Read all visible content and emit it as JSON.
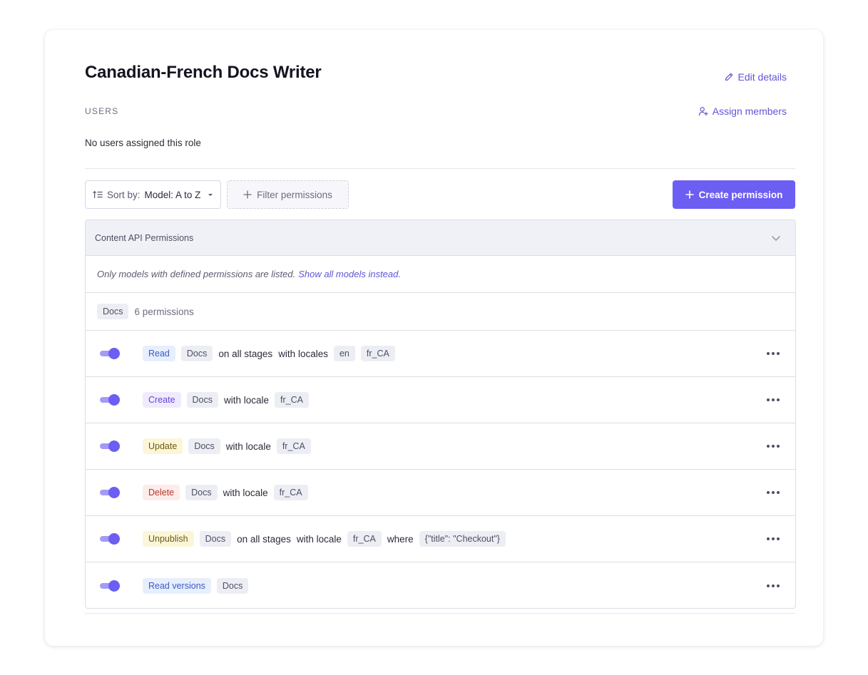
{
  "header": {
    "title": "Canadian-French Docs Writer",
    "edit_label": "Edit details",
    "assign_label": "Assign members"
  },
  "users": {
    "section_label": "USERS",
    "empty_text": "No users assigned this role"
  },
  "toolbar": {
    "sort_prefix": "Sort by:",
    "sort_value": "Model: A to Z",
    "filter_label": "Filter permissions",
    "create_label": "Create permission"
  },
  "panel": {
    "title": "Content API Permissions",
    "note_text": "Only models with defined permissions are listed.",
    "note_link": "Show all models instead.",
    "model_name": "Docs",
    "model_count": "6 permissions"
  },
  "permissions": [
    {
      "action": "Read",
      "model": "Docs",
      "text1": "on all stages",
      "text2": "with locales",
      "locales": [
        "en",
        "fr_CA"
      ]
    },
    {
      "action": "Create",
      "model": "Docs",
      "text1": "with locale",
      "locales": [
        "fr_CA"
      ]
    },
    {
      "action": "Update",
      "model": "Docs",
      "text1": "with locale",
      "locales": [
        "fr_CA"
      ]
    },
    {
      "action": "Delete",
      "model": "Docs",
      "text1": "with locale",
      "locales": [
        "fr_CA"
      ]
    },
    {
      "action": "Unpublish",
      "model": "Docs",
      "text1": "on all stages",
      "text2": "with locale",
      "locales": [
        "fr_CA"
      ],
      "where_label": "where",
      "condition": "{\"title\": \"Checkout\"}"
    },
    {
      "action": "Read versions",
      "model": "Docs"
    }
  ],
  "colors": {
    "accent": "#6c5ef2",
    "link": "#6155d8"
  }
}
